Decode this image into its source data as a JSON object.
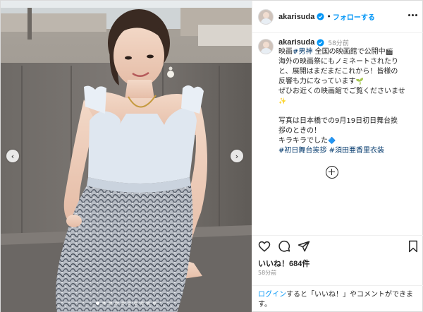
{
  "colors": {
    "link_blue": "#0095f6",
    "hashtag": "#00376b",
    "text": "#262626",
    "secondary": "#8e8e8e",
    "border": "#dbdbdb"
  },
  "photo": {
    "slide_count": 10,
    "active_slide": 1,
    "prev_icon": "chevron-left-icon",
    "next_icon": "chevron-right-icon",
    "prev_glyph": "‹",
    "next_glyph": "›"
  },
  "header": {
    "username": "akarisuda",
    "separator": "•",
    "follow_label": "フォローする",
    "more_icon": "more-options-icon"
  },
  "caption": {
    "username": "akarisuda",
    "time_ago": "58分前",
    "line1_pre": "映画",
    "line1_tag": "#男神",
    "line1_post": " 全国の映画館で公開中",
    "line1_emoji": "🎬",
    "line2": "海外の映画祭にもノミネートされたり",
    "line3": "と、展開はまだまだこれから！皆様の",
    "line4": "反響も力になっています",
    "line4_emoji": "🌱",
    "line5": "ぜひお近くの映画館でご覧くださいませ",
    "line6_emoji": "✨",
    "line7": "写真は日本橋での9月19日初日舞台挨",
    "line8": "拶のときの！",
    "line9": "キラキラでした",
    "line9_emoji": "🔷",
    "tag2": "#初日舞台挨拶",
    "tag3": "#須田亜香里衣装"
  },
  "load_more_icon": "plus-circle-icon",
  "actions": {
    "like_icon": "heart-icon",
    "comment_icon": "comment-icon",
    "share_icon": "paper-plane-icon",
    "save_icon": "bookmark-icon",
    "likes": "いいね！684件",
    "posted": "58分前"
  },
  "login_prompt": {
    "link": "ログイン",
    "text": "すると「いいね！」やコメントができます。"
  }
}
